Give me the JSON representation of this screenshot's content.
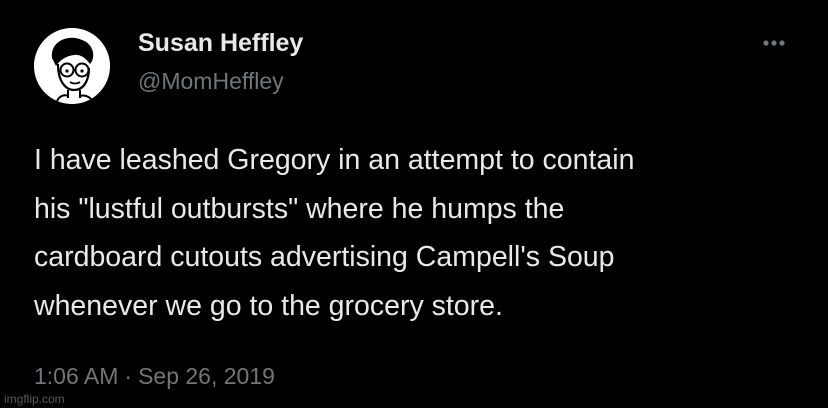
{
  "colors": {
    "background": "#000000",
    "primary_text": "#e7e9ea",
    "secondary_text": "#71767b"
  },
  "author": {
    "display_name": "Susan Heffley",
    "handle": "@MomHeffley",
    "avatar_icon": "cartoon-woman-avatar-icon"
  },
  "more_menu": {
    "icon": "more-horizontal-icon"
  },
  "tweet": {
    "lines": [
      "I have leashed Gregory in an attempt to contain",
      "his \"lustful outbursts\" where he humps the",
      "cardboard cutouts advertising Campell's Soup",
      "whenever we go to the grocery store."
    ],
    "time": "1:06 AM",
    "separator": "·",
    "date": "Sep 26, 2019"
  },
  "watermark": "imgflip.com"
}
